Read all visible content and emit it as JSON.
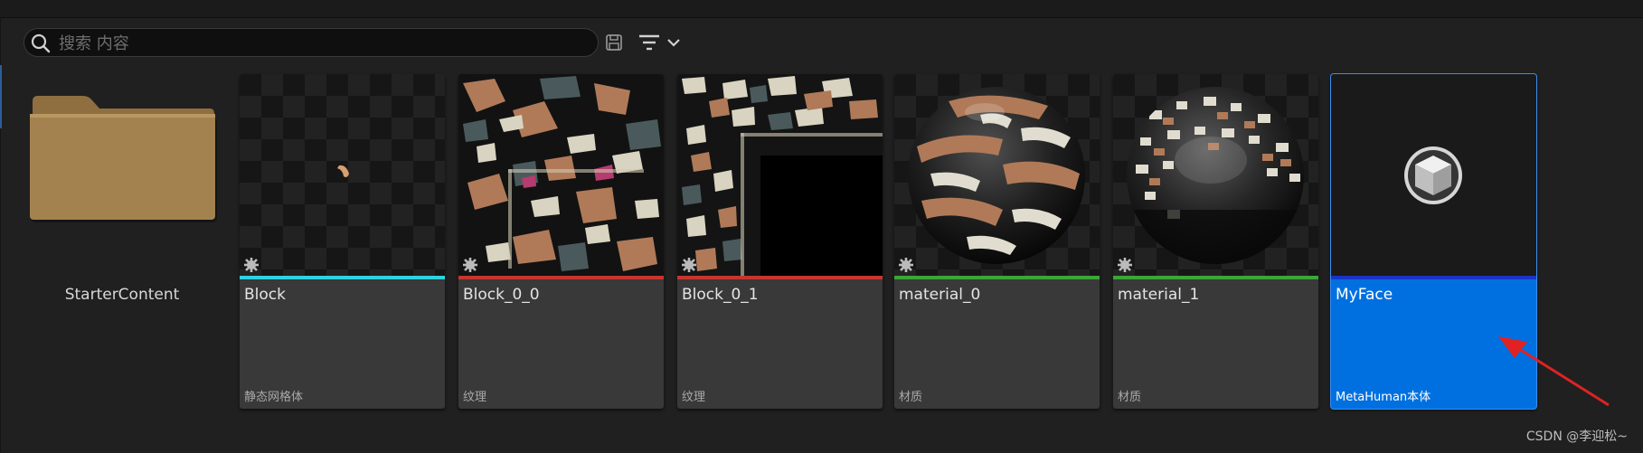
{
  "search": {
    "placeholder": "搜索 内容",
    "value": ""
  },
  "toolbar": {
    "save_icon": "save-icon",
    "filter_icon": "filter-icon",
    "dropdown_icon": "chevron-down-icon"
  },
  "colors": {
    "texture_bar": "#c8342f",
    "material_bar": "#3aa637",
    "staticmesh_bar": "#2fd2e0",
    "metahuman_bar": "#1c33c8",
    "selected_tile": "#0070e0",
    "annotation_arrow": "#e02222"
  },
  "assets": {
    "folder": {
      "label": "StarterContent"
    },
    "items": [
      {
        "name": "Block",
        "type": "静态网格体"
      },
      {
        "name": "Block_0_0",
        "type": "纹理"
      },
      {
        "name": "Block_0_1",
        "type": "纹理"
      },
      {
        "name": "material_0",
        "type": "材质"
      },
      {
        "name": "material_1",
        "type": "材质"
      },
      {
        "name": "MyFace",
        "type": "MetaHuman本体",
        "selected": true
      }
    ]
  },
  "watermark": "CSDN @李迎松~"
}
